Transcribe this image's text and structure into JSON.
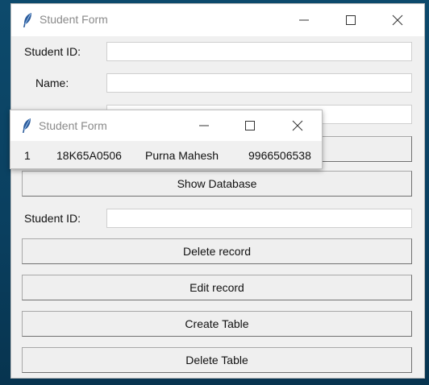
{
  "main_window": {
    "title": "Student Form",
    "fields": {
      "student_id_label": "Student ID:",
      "student_id_value": "",
      "name_label": "Name:",
      "name_value": "",
      "phone_value": ""
    },
    "buttons": {
      "show_database": "Show Database",
      "delete_record": "Delete record",
      "edit_record": "Edit record",
      "create_table": "Create Table",
      "delete_table": "Delete Table"
    },
    "delete_section": {
      "student_id_label": "Student ID:",
      "student_id_value": ""
    }
  },
  "popup_window": {
    "title": "Student Form",
    "record": {
      "index": "1",
      "student_id": "18K65A0506",
      "name": "Purna Mahesh",
      "phone": "9966506538"
    }
  },
  "icons": {
    "app": "feather-icon",
    "minimize": "minimize-icon",
    "maximize": "maximize-icon",
    "close": "close-icon"
  }
}
